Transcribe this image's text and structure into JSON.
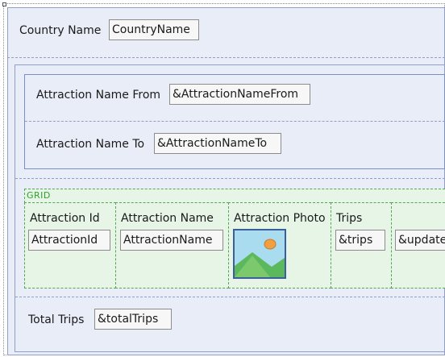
{
  "header": {
    "country_label": "Country Name",
    "country_field": "CountryName"
  },
  "filters": {
    "from_label": "Attraction Name From",
    "from_field": "&AttractionNameFrom",
    "to_label": "Attraction Name To",
    "to_field": "&AttractionNameTo"
  },
  "grid": {
    "title": "GRID",
    "columns": [
      {
        "header": "Attraction Id",
        "value": "AttractionId"
      },
      {
        "header": "Attraction Name",
        "value": "AttractionName"
      },
      {
        "header": "Attraction Photo",
        "value": "photo-placeholder-icon"
      },
      {
        "header": "Trips",
        "value": "&trips"
      },
      {
        "header": "",
        "value": "&update"
      }
    ]
  },
  "footer": {
    "total_label": "Total Trips",
    "total_field": "&totalTrips"
  }
}
